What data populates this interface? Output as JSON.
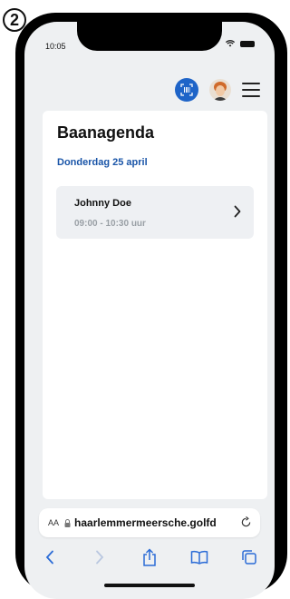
{
  "badge": {
    "step": "2"
  },
  "status_bar": {
    "time": "10:05"
  },
  "page": {
    "title": "Baanagenda",
    "date": "Donderdag 25 april",
    "bookings": [
      {
        "name": "Johnny Doe",
        "time": "09:00 - 10:30 uur"
      }
    ]
  },
  "browser": {
    "aa_label": "AA",
    "url": "haarlemmermeersche.golfd"
  },
  "colors": {
    "accent": "#1a55a8",
    "qr_button": "#1e64c8"
  },
  "icons": [
    "qr-code-icon",
    "avatar",
    "menu-icon",
    "chevron-right-icon",
    "lock-icon",
    "reload-icon",
    "back-icon",
    "forward-icon",
    "share-icon",
    "bookmarks-icon",
    "tabs-icon"
  ]
}
